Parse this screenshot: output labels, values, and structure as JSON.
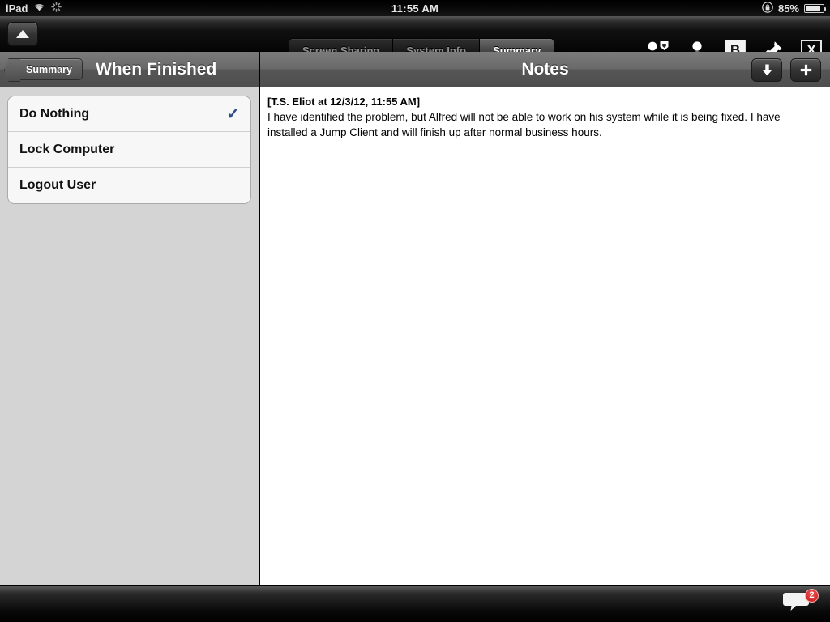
{
  "status_bar": {
    "carrier": "iPad",
    "wifi_icon": "wifi-icon",
    "activity_icon": "activity-spinner-icon",
    "time": "11:55 AM",
    "rotation_lock_icon": "rotation-lock-icon",
    "battery_percent": "85%",
    "battery_level": 85
  },
  "toolbar": {
    "up_button_icon": "triangle-up-icon",
    "tabs": [
      {
        "label": "Screen Sharing",
        "active": false
      },
      {
        "label": "System Info",
        "active": false
      },
      {
        "label": "Summary",
        "active": true
      }
    ],
    "icons": [
      {
        "name": "participants-icon",
        "glyph": ""
      },
      {
        "name": "person-icon",
        "glyph": ""
      },
      {
        "name": "bold-b-icon",
        "glyph": "B"
      },
      {
        "name": "pin-icon",
        "glyph": ""
      },
      {
        "name": "close-x-icon",
        "glyph": "X"
      }
    ]
  },
  "sidebar": {
    "back_button_label": "Summary",
    "title": "When Finished",
    "options": [
      {
        "label": "Do Nothing",
        "checked": true
      },
      {
        "label": "Lock Computer",
        "checked": false
      },
      {
        "label": "Logout User",
        "checked": false
      }
    ],
    "checkmark_glyph": "✓",
    "checkmark_color": "#2f4b8c"
  },
  "notes": {
    "title": "Notes",
    "download_button_icon": "arrow-down-icon",
    "add_button_icon": "plus-icon",
    "entries": [
      {
        "header": "[T.S. Eliot at 12/3/12, 11:55 AM]",
        "body": "I have identified the problem, but Alfred will not be able to work on his system while it is being fixed. I have installed a Jump Client and will finish up after normal business hours."
      }
    ]
  },
  "bottom_bar": {
    "chat_icon": "chat-bubble-icon",
    "chat_badge_count": "2",
    "badge_color": "#c91616"
  }
}
